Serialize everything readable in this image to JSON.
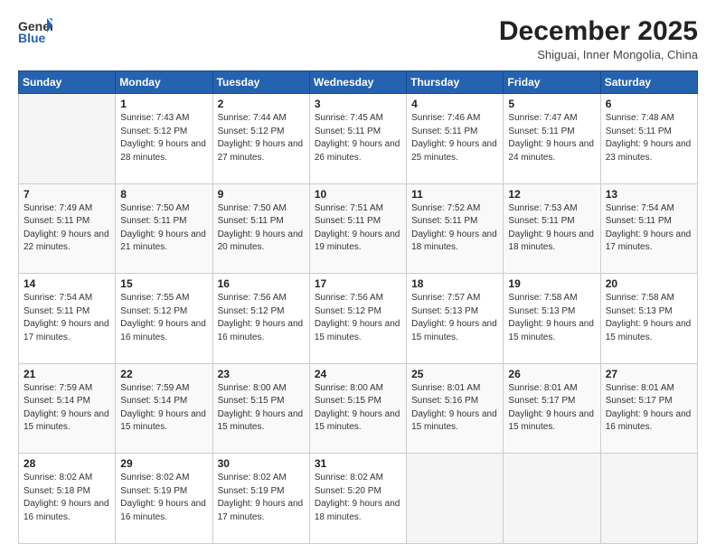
{
  "header": {
    "logo_general": "General",
    "logo_blue": "Blue",
    "title": "December 2025",
    "location": "Shiguai, Inner Mongolia, China"
  },
  "weekdays": [
    "Sunday",
    "Monday",
    "Tuesday",
    "Wednesday",
    "Thursday",
    "Friday",
    "Saturday"
  ],
  "weeks": [
    [
      {
        "day": "",
        "sunrise": "",
        "sunset": "",
        "daylight": ""
      },
      {
        "day": "1",
        "sunrise": "Sunrise: 7:43 AM",
        "sunset": "Sunset: 5:12 PM",
        "daylight": "Daylight: 9 hours and 28 minutes."
      },
      {
        "day": "2",
        "sunrise": "Sunrise: 7:44 AM",
        "sunset": "Sunset: 5:12 PM",
        "daylight": "Daylight: 9 hours and 27 minutes."
      },
      {
        "day": "3",
        "sunrise": "Sunrise: 7:45 AM",
        "sunset": "Sunset: 5:11 PM",
        "daylight": "Daylight: 9 hours and 26 minutes."
      },
      {
        "day": "4",
        "sunrise": "Sunrise: 7:46 AM",
        "sunset": "Sunset: 5:11 PM",
        "daylight": "Daylight: 9 hours and 25 minutes."
      },
      {
        "day": "5",
        "sunrise": "Sunrise: 7:47 AM",
        "sunset": "Sunset: 5:11 PM",
        "daylight": "Daylight: 9 hours and 24 minutes."
      },
      {
        "day": "6",
        "sunrise": "Sunrise: 7:48 AM",
        "sunset": "Sunset: 5:11 PM",
        "daylight": "Daylight: 9 hours and 23 minutes."
      }
    ],
    [
      {
        "day": "7",
        "sunrise": "Sunrise: 7:49 AM",
        "sunset": "Sunset: 5:11 PM",
        "daylight": "Daylight: 9 hours and 22 minutes."
      },
      {
        "day": "8",
        "sunrise": "Sunrise: 7:50 AM",
        "sunset": "Sunset: 5:11 PM",
        "daylight": "Daylight: 9 hours and 21 minutes."
      },
      {
        "day": "9",
        "sunrise": "Sunrise: 7:50 AM",
        "sunset": "Sunset: 5:11 PM",
        "daylight": "Daylight: 9 hours and 20 minutes."
      },
      {
        "day": "10",
        "sunrise": "Sunrise: 7:51 AM",
        "sunset": "Sunset: 5:11 PM",
        "daylight": "Daylight: 9 hours and 19 minutes."
      },
      {
        "day": "11",
        "sunrise": "Sunrise: 7:52 AM",
        "sunset": "Sunset: 5:11 PM",
        "daylight": "Daylight: 9 hours and 18 minutes."
      },
      {
        "day": "12",
        "sunrise": "Sunrise: 7:53 AM",
        "sunset": "Sunset: 5:11 PM",
        "daylight": "Daylight: 9 hours and 18 minutes."
      },
      {
        "day": "13",
        "sunrise": "Sunrise: 7:54 AM",
        "sunset": "Sunset: 5:11 PM",
        "daylight": "Daylight: 9 hours and 17 minutes."
      }
    ],
    [
      {
        "day": "14",
        "sunrise": "Sunrise: 7:54 AM",
        "sunset": "Sunset: 5:11 PM",
        "daylight": "Daylight: 9 hours and 17 minutes."
      },
      {
        "day": "15",
        "sunrise": "Sunrise: 7:55 AM",
        "sunset": "Sunset: 5:12 PM",
        "daylight": "Daylight: 9 hours and 16 minutes."
      },
      {
        "day": "16",
        "sunrise": "Sunrise: 7:56 AM",
        "sunset": "Sunset: 5:12 PM",
        "daylight": "Daylight: 9 hours and 16 minutes."
      },
      {
        "day": "17",
        "sunrise": "Sunrise: 7:56 AM",
        "sunset": "Sunset: 5:12 PM",
        "daylight": "Daylight: 9 hours and 15 minutes."
      },
      {
        "day": "18",
        "sunrise": "Sunrise: 7:57 AM",
        "sunset": "Sunset: 5:13 PM",
        "daylight": "Daylight: 9 hours and 15 minutes."
      },
      {
        "day": "19",
        "sunrise": "Sunrise: 7:58 AM",
        "sunset": "Sunset: 5:13 PM",
        "daylight": "Daylight: 9 hours and 15 minutes."
      },
      {
        "day": "20",
        "sunrise": "Sunrise: 7:58 AM",
        "sunset": "Sunset: 5:13 PM",
        "daylight": "Daylight: 9 hours and 15 minutes."
      }
    ],
    [
      {
        "day": "21",
        "sunrise": "Sunrise: 7:59 AM",
        "sunset": "Sunset: 5:14 PM",
        "daylight": "Daylight: 9 hours and 15 minutes."
      },
      {
        "day": "22",
        "sunrise": "Sunrise: 7:59 AM",
        "sunset": "Sunset: 5:14 PM",
        "daylight": "Daylight: 9 hours and 15 minutes."
      },
      {
        "day": "23",
        "sunrise": "Sunrise: 8:00 AM",
        "sunset": "Sunset: 5:15 PM",
        "daylight": "Daylight: 9 hours and 15 minutes."
      },
      {
        "day": "24",
        "sunrise": "Sunrise: 8:00 AM",
        "sunset": "Sunset: 5:15 PM",
        "daylight": "Daylight: 9 hours and 15 minutes."
      },
      {
        "day": "25",
        "sunrise": "Sunrise: 8:01 AM",
        "sunset": "Sunset: 5:16 PM",
        "daylight": "Daylight: 9 hours and 15 minutes."
      },
      {
        "day": "26",
        "sunrise": "Sunrise: 8:01 AM",
        "sunset": "Sunset: 5:17 PM",
        "daylight": "Daylight: 9 hours and 15 minutes."
      },
      {
        "day": "27",
        "sunrise": "Sunrise: 8:01 AM",
        "sunset": "Sunset: 5:17 PM",
        "daylight": "Daylight: 9 hours and 16 minutes."
      }
    ],
    [
      {
        "day": "28",
        "sunrise": "Sunrise: 8:02 AM",
        "sunset": "Sunset: 5:18 PM",
        "daylight": "Daylight: 9 hours and 16 minutes."
      },
      {
        "day": "29",
        "sunrise": "Sunrise: 8:02 AM",
        "sunset": "Sunset: 5:19 PM",
        "daylight": "Daylight: 9 hours and 16 minutes."
      },
      {
        "day": "30",
        "sunrise": "Sunrise: 8:02 AM",
        "sunset": "Sunset: 5:19 PM",
        "daylight": "Daylight: 9 hours and 17 minutes."
      },
      {
        "day": "31",
        "sunrise": "Sunrise: 8:02 AM",
        "sunset": "Sunset: 5:20 PM",
        "daylight": "Daylight: 9 hours and 18 minutes."
      },
      {
        "day": "",
        "sunrise": "",
        "sunset": "",
        "daylight": ""
      },
      {
        "day": "",
        "sunrise": "",
        "sunset": "",
        "daylight": ""
      },
      {
        "day": "",
        "sunrise": "",
        "sunset": "",
        "daylight": ""
      }
    ]
  ]
}
